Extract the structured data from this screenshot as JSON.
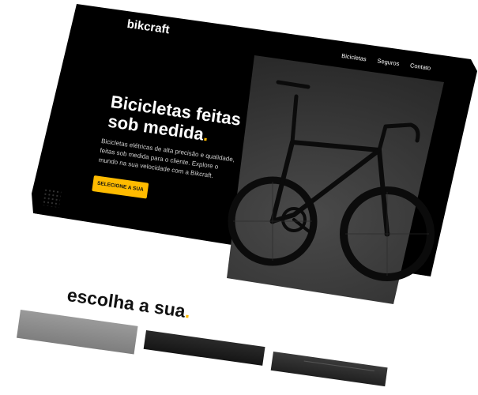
{
  "header": {
    "logo": "bikcraft",
    "nav": [
      "Bicicletas",
      "Seguros",
      "Contato"
    ]
  },
  "hero": {
    "title_line1": "Bicicletas feitas",
    "title_line2": "sob medida",
    "title_dot": ".",
    "description": "Bicicletas elétricas de alta precisão e qualidade, feitas sob medida para o cliente. Explore o mundo na sua velocidade com a Bikcraft.",
    "cta_label": "SELECIONE A SUA"
  },
  "section": {
    "title": "escolha a sua",
    "title_dot": "."
  },
  "colors": {
    "accent": "#ffbb00",
    "hero_bg": "#000000",
    "page_bg": "#ffffff"
  }
}
